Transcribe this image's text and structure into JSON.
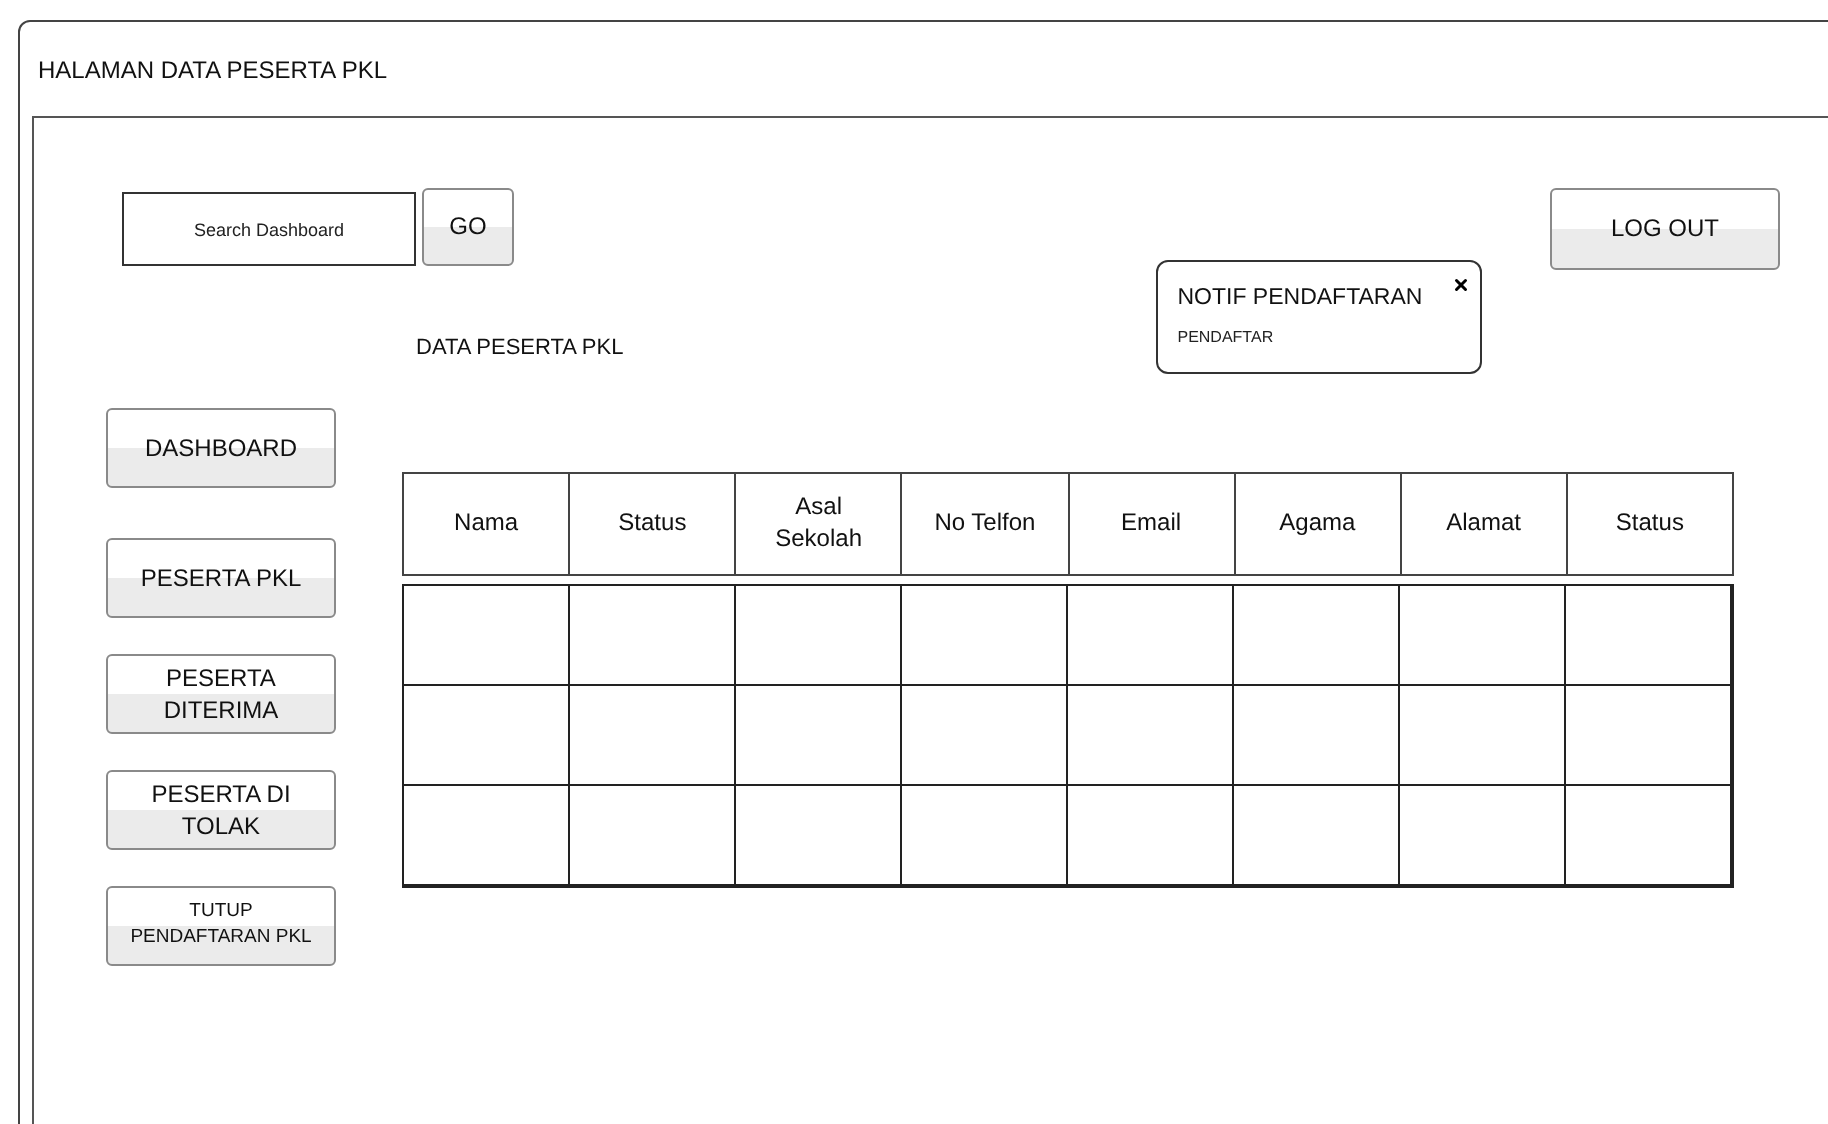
{
  "window": {
    "title": "HALAMAN DATA PESERTA PKL"
  },
  "search": {
    "placeholder": "Search Dashboard"
  },
  "go_button": "GO",
  "logout_button": "LOG OUT",
  "notification": {
    "title": "NOTIF PENDAFTARAN",
    "text": "PENDAFTAR"
  },
  "section_title": "DATA PESERTA PKL",
  "sidebar": {
    "items": [
      {
        "label": "DASHBOARD",
        "kind": "normal"
      },
      {
        "label": "PESERTA PKL",
        "kind": "normal"
      },
      {
        "label": "PESERTA\nDITERIMA",
        "kind": "normal"
      },
      {
        "label": "PESERTA DI\nTOLAK",
        "kind": "normal"
      },
      {
        "label": "TUTUP\nPENDAFTARAN PKL",
        "kind": "compact"
      }
    ]
  },
  "table": {
    "columns": [
      "Nama",
      "Status",
      "Asal\nSekolah",
      "No Telfon",
      "Email",
      "Agama",
      "Alamat",
      "Status"
    ]
  }
}
